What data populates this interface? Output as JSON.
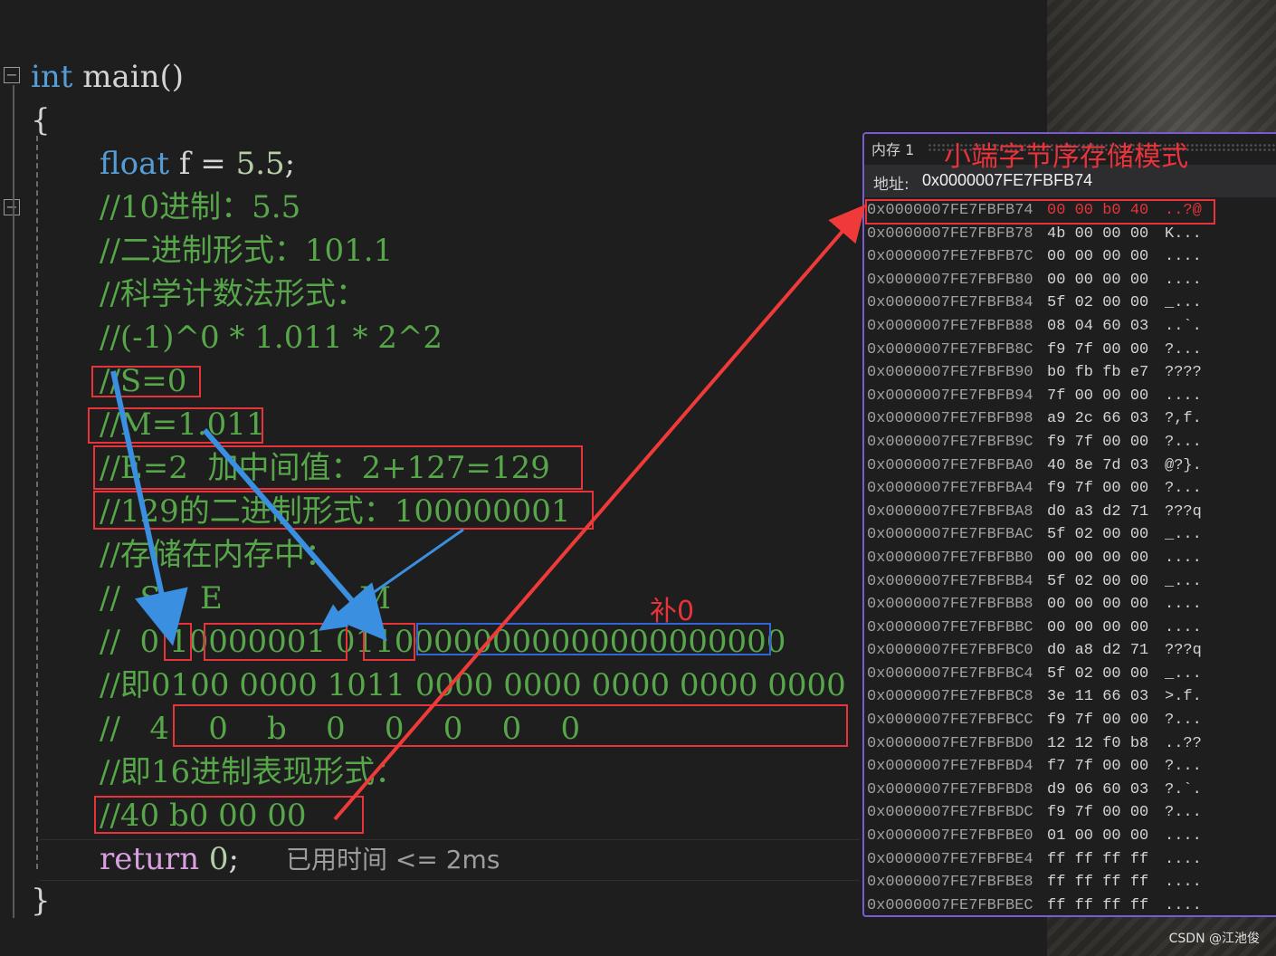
{
  "editor": {
    "lines": [
      {
        "id": "l1",
        "segments": [
          {
            "c": "kw",
            "t": "int"
          },
          {
            "c": "pl",
            "t": " main()"
          }
        ]
      },
      {
        "id": "l2",
        "segments": [
          {
            "c": "pl",
            "t": "{"
          }
        ]
      },
      {
        "id": "l3",
        "segments": [
          {
            "c": "kw",
            "t": "float"
          },
          {
            "c": "pl",
            "t": " f = "
          },
          {
            "c": "num",
            "t": "5.5"
          },
          {
            "c": "pl",
            "t": ";"
          }
        ]
      },
      {
        "id": "l4",
        "segments": [
          {
            "c": "cm",
            "t": "//10进制：5.5"
          }
        ]
      },
      {
        "id": "l5",
        "segments": [
          {
            "c": "cm",
            "t": "//二进制形式：101.1"
          }
        ]
      },
      {
        "id": "l6",
        "segments": [
          {
            "c": "cm",
            "t": "//科学计数法形式："
          }
        ]
      },
      {
        "id": "l7",
        "segments": [
          {
            "c": "cm",
            "t": "//(-1)^0 * 1.011 * 2^2"
          }
        ]
      },
      {
        "id": "l8",
        "segments": [
          {
            "c": "cm",
            "t": "//S=0"
          }
        ]
      },
      {
        "id": "l9",
        "segments": [
          {
            "c": "cm",
            "t": "//M=1.011"
          }
        ]
      },
      {
        "id": "l10",
        "segments": [
          {
            "c": "cm",
            "t": "//E=2  加中间值：2+127=129"
          }
        ]
      },
      {
        "id": "l11",
        "segments": [
          {
            "c": "cm",
            "t": "//129的二进制形式：100000001"
          }
        ]
      },
      {
        "id": "l12",
        "segments": [
          {
            "c": "cm",
            "t": "//存储在内存中："
          }
        ]
      },
      {
        "id": "l13",
        "segments": [
          {
            "c": "cm",
            "t": "//  S    E              M"
          }
        ]
      },
      {
        "id": "l14",
        "segments": [
          {
            "c": "cm",
            "t": "//  0 10000001 01100000000000000000000"
          }
        ]
      },
      {
        "id": "l15",
        "segments": [
          {
            "c": "cm",
            "t": "//即0100 0000 1011 0000 0000 0000 0000 0000"
          }
        ]
      },
      {
        "id": "l16",
        "segments": [
          {
            "c": "cm",
            "t": "//   4    0    b    0    0    0    0    0"
          }
        ]
      },
      {
        "id": "l17",
        "segments": [
          {
            "c": "cm",
            "t": "//即16进制表现形式："
          }
        ]
      },
      {
        "id": "l18",
        "segments": [
          {
            "c": "cm",
            "t": "//40 b0 00 00"
          }
        ]
      },
      {
        "id": "l19",
        "segments": [
          {
            "c": "ret",
            "t": "return"
          },
          {
            "c": "pl",
            "t": " "
          },
          {
            "c": "num",
            "t": "0"
          },
          {
            "c": "pl",
            "t": ";"
          }
        ]
      },
      {
        "id": "l20",
        "segments": [
          {
            "c": "pl",
            "t": "}"
          }
        ]
      }
    ],
    "perf_hint": "已用时间 <= 2ms",
    "fill_zero_note": "补0"
  },
  "memory_window": {
    "title": "内存 1",
    "caption": "小端字节序存储模式",
    "address_label": "地址:",
    "address_value": "0x0000007FE7FBFB74",
    "rows": [
      {
        "addr": "0x0000007FE7FBFB74",
        "bytes": "00 00 b0 40",
        "ascii": "..?@"
      },
      {
        "addr": "0x0000007FE7FBFB78",
        "bytes": "4b 00 00 00",
        "ascii": "K..."
      },
      {
        "addr": "0x0000007FE7FBFB7C",
        "bytes": "00 00 00 00",
        "ascii": "...."
      },
      {
        "addr": "0x0000007FE7FBFB80",
        "bytes": "00 00 00 00",
        "ascii": "...."
      },
      {
        "addr": "0x0000007FE7FBFB84",
        "bytes": "5f 02 00 00",
        "ascii": "_..."
      },
      {
        "addr": "0x0000007FE7FBFB88",
        "bytes": "08 04 60 03",
        "ascii": "..`."
      },
      {
        "addr": "0x0000007FE7FBFB8C",
        "bytes": "f9 7f 00 00",
        "ascii": "?..."
      },
      {
        "addr": "0x0000007FE7FBFB90",
        "bytes": "b0 fb fb e7",
        "ascii": "????"
      },
      {
        "addr": "0x0000007FE7FBFB94",
        "bytes": "7f 00 00 00",
        "ascii": "...."
      },
      {
        "addr": "0x0000007FE7FBFB98",
        "bytes": "a9 2c 66 03",
        "ascii": "?,f."
      },
      {
        "addr": "0x0000007FE7FBFB9C",
        "bytes": "f9 7f 00 00",
        "ascii": "?..."
      },
      {
        "addr": "0x0000007FE7FBFBA0",
        "bytes": "40 8e 7d 03",
        "ascii": "@?}."
      },
      {
        "addr": "0x0000007FE7FBFBA4",
        "bytes": "f9 7f 00 00",
        "ascii": "?..."
      },
      {
        "addr": "0x0000007FE7FBFBA8",
        "bytes": "d0 a3 d2 71",
        "ascii": "???q"
      },
      {
        "addr": "0x0000007FE7FBFBAC",
        "bytes": "5f 02 00 00",
        "ascii": "_..."
      },
      {
        "addr": "0x0000007FE7FBFBB0",
        "bytes": "00 00 00 00",
        "ascii": "...."
      },
      {
        "addr": "0x0000007FE7FBFBB4",
        "bytes": "5f 02 00 00",
        "ascii": "_..."
      },
      {
        "addr": "0x0000007FE7FBFBB8",
        "bytes": "00 00 00 00",
        "ascii": "...."
      },
      {
        "addr": "0x0000007FE7FBFBBC",
        "bytes": "00 00 00 00",
        "ascii": "...."
      },
      {
        "addr": "0x0000007FE7FBFBC0",
        "bytes": "d0 a8 d2 71",
        "ascii": "???q"
      },
      {
        "addr": "0x0000007FE7FBFBC4",
        "bytes": "5f 02 00 00",
        "ascii": "_..."
      },
      {
        "addr": "0x0000007FE7FBFBC8",
        "bytes": "3e 11 66 03",
        "ascii": ">.f."
      },
      {
        "addr": "0x0000007FE7FBFBCC",
        "bytes": "f9 7f 00 00",
        "ascii": "?..."
      },
      {
        "addr": "0x0000007FE7FBFBD0",
        "bytes": "12 12 f0 b8",
        "ascii": "..??"
      },
      {
        "addr": "0x0000007FE7FBFBD4",
        "bytes": "f7 7f 00 00",
        "ascii": "?..."
      },
      {
        "addr": "0x0000007FE7FBFBD8",
        "bytes": "d9 06 60 03",
        "ascii": "?.`."
      },
      {
        "addr": "0x0000007FE7FBFBDC",
        "bytes": "f9 7f 00 00",
        "ascii": "?..."
      },
      {
        "addr": "0x0000007FE7FBFBE0",
        "bytes": "01 00 00 00",
        "ascii": "...."
      },
      {
        "addr": "0x0000007FE7FBFBE4",
        "bytes": "ff ff ff ff",
        "ascii": "...."
      },
      {
        "addr": "0x0000007FE7FBFBE8",
        "bytes": "ff ff ff ff",
        "ascii": "...."
      },
      {
        "addr": "0x0000007FE7FBFBEC",
        "bytes": "ff ff ff ff",
        "ascii": "...."
      }
    ]
  },
  "watermark": "CSDN @江池俊",
  "colors": {
    "keyword": "#569cd6",
    "comment": "#57a64a",
    "number": "#b5cea8",
    "annotation_red": "#e8333b",
    "annotation_blue": "#3465d4",
    "arrow_blue": "#3b8fe0"
  }
}
